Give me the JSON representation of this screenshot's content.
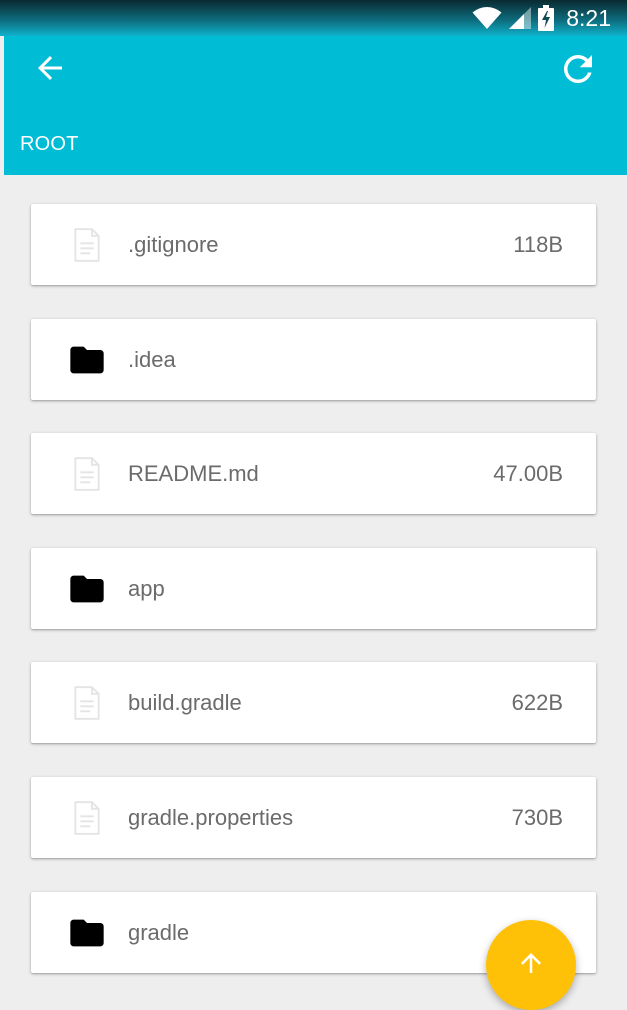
{
  "status_bar": {
    "time": "8:21",
    "icons": [
      "wifi-icon",
      "signal-icon",
      "battery-charging-icon"
    ]
  },
  "app_bar": {
    "back_icon": "arrow-back-icon",
    "refresh_icon": "refresh-icon",
    "path": "ROOT",
    "color": "#00bcd4"
  },
  "files": [
    {
      "type": "file",
      "name": ".gitignore",
      "size": "118B"
    },
    {
      "type": "folder",
      "name": ".idea",
      "size": ""
    },
    {
      "type": "file",
      "name": "README.md",
      "size": "47.00B"
    },
    {
      "type": "folder",
      "name": "app",
      "size": ""
    },
    {
      "type": "file",
      "name": "build.gradle",
      "size": "622B"
    },
    {
      "type": "file",
      "name": "gradle.properties",
      "size": "730B"
    },
    {
      "type": "folder",
      "name": "gradle",
      "size": ""
    }
  ],
  "fab": {
    "icon": "arrow-up-icon",
    "color": "#ffc107"
  }
}
